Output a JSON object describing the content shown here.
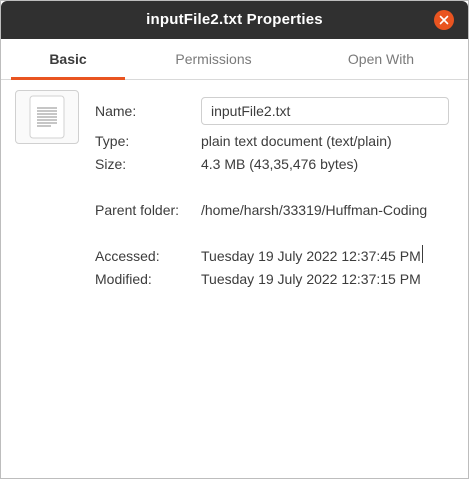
{
  "window": {
    "title": "inputFile2.txt Properties"
  },
  "tabs": [
    {
      "label": "Basic",
      "active": true
    },
    {
      "label": "Permissions",
      "active": false
    },
    {
      "label": "Open With",
      "active": false
    }
  ],
  "file_icon": "text-document-icon",
  "fields": {
    "name_label": "Name:",
    "name_value": "inputFile2.txt",
    "type_label": "Type:",
    "type_value": "plain text document (text/plain)",
    "size_label": "Size:",
    "size_value": "4.3 MB (43,35,476 bytes)",
    "parent_label": "Parent folder:",
    "parent_value": "/home/harsh/33319/Huffman-Coding",
    "accessed_label": "Accessed:",
    "accessed_value": "Tuesday 19 July 2022 12:37:45 PM",
    "modified_label": "Modified:",
    "modified_value": "Tuesday 19 July 2022 12:37:15 PM"
  },
  "colors": {
    "accent": "#e95420",
    "titlebar": "#303030"
  }
}
